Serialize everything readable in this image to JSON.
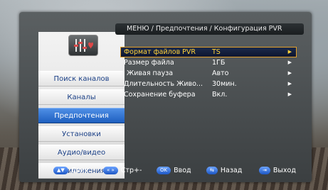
{
  "header": {
    "breadcrumb": "МЕНЮ / Предпочтения / Конфигурация PVR"
  },
  "sidebar": {
    "items": [
      {
        "label": "Поиск каналов",
        "active": false
      },
      {
        "label": "Каналы",
        "active": false
      },
      {
        "label": "Предпочтения",
        "active": true
      },
      {
        "label": "Установки",
        "active": false
      },
      {
        "label": "Аудио/видео",
        "active": false
      },
      {
        "label": "Приложения",
        "active": false
      }
    ]
  },
  "settings": {
    "rows": [
      {
        "label": "Формат файлов PVR",
        "value": "TS",
        "selected": true
      },
      {
        "label": "Размер файла",
        "value": "1ГБ",
        "selected": false
      },
      {
        "label": "Живая пауза",
        "value": "Авто",
        "selected": false
      },
      {
        "label": "Длительность Живо...",
        "value": "30мин.",
        "selected": false
      },
      {
        "label": "Сохранение буфера",
        "value": "Вкл.",
        "selected": false
      }
    ]
  },
  "footer": {
    "move": {
      "key": "▲▼",
      "label": "Двиг."
    },
    "page": {
      "key": "« »",
      "label": "Стр+-"
    },
    "ok": {
      "key": "OK",
      "label": "Ввод"
    },
    "back": {
      "key": "⇆",
      "label": "Назад"
    },
    "exit": {
      "key": "⇥",
      "label": "Выход"
    }
  },
  "colors": {
    "accent": "#2f6fd6",
    "selected_text": "#ffd23a",
    "selected_border": "#e3a02a",
    "menu_text": "#1a3f86"
  },
  "icons": [
    "settings-sliders-heart-icon",
    "arrow-right-icon"
  ]
}
